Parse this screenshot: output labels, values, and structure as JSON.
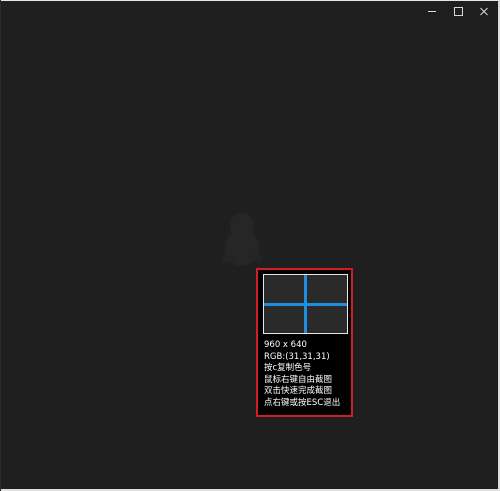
{
  "window": {
    "controls": {
      "minimize_icon": "minimize-icon",
      "maximize_icon": "maximize-icon",
      "close_icon": "close-icon"
    }
  },
  "colors": {
    "background": "#1f1f1f",
    "highlight_border": "#d21e1e",
    "crosshair": "#1e8fe0",
    "text": "#ffffff"
  },
  "picker": {
    "size": "960 x 640",
    "rgb": "RGB:(31,31,31)",
    "lines": [
      "按c复制色号",
      "鼠标右键自由截图",
      "双击快速完成截图",
      "点右键或按ESC退出"
    ]
  }
}
